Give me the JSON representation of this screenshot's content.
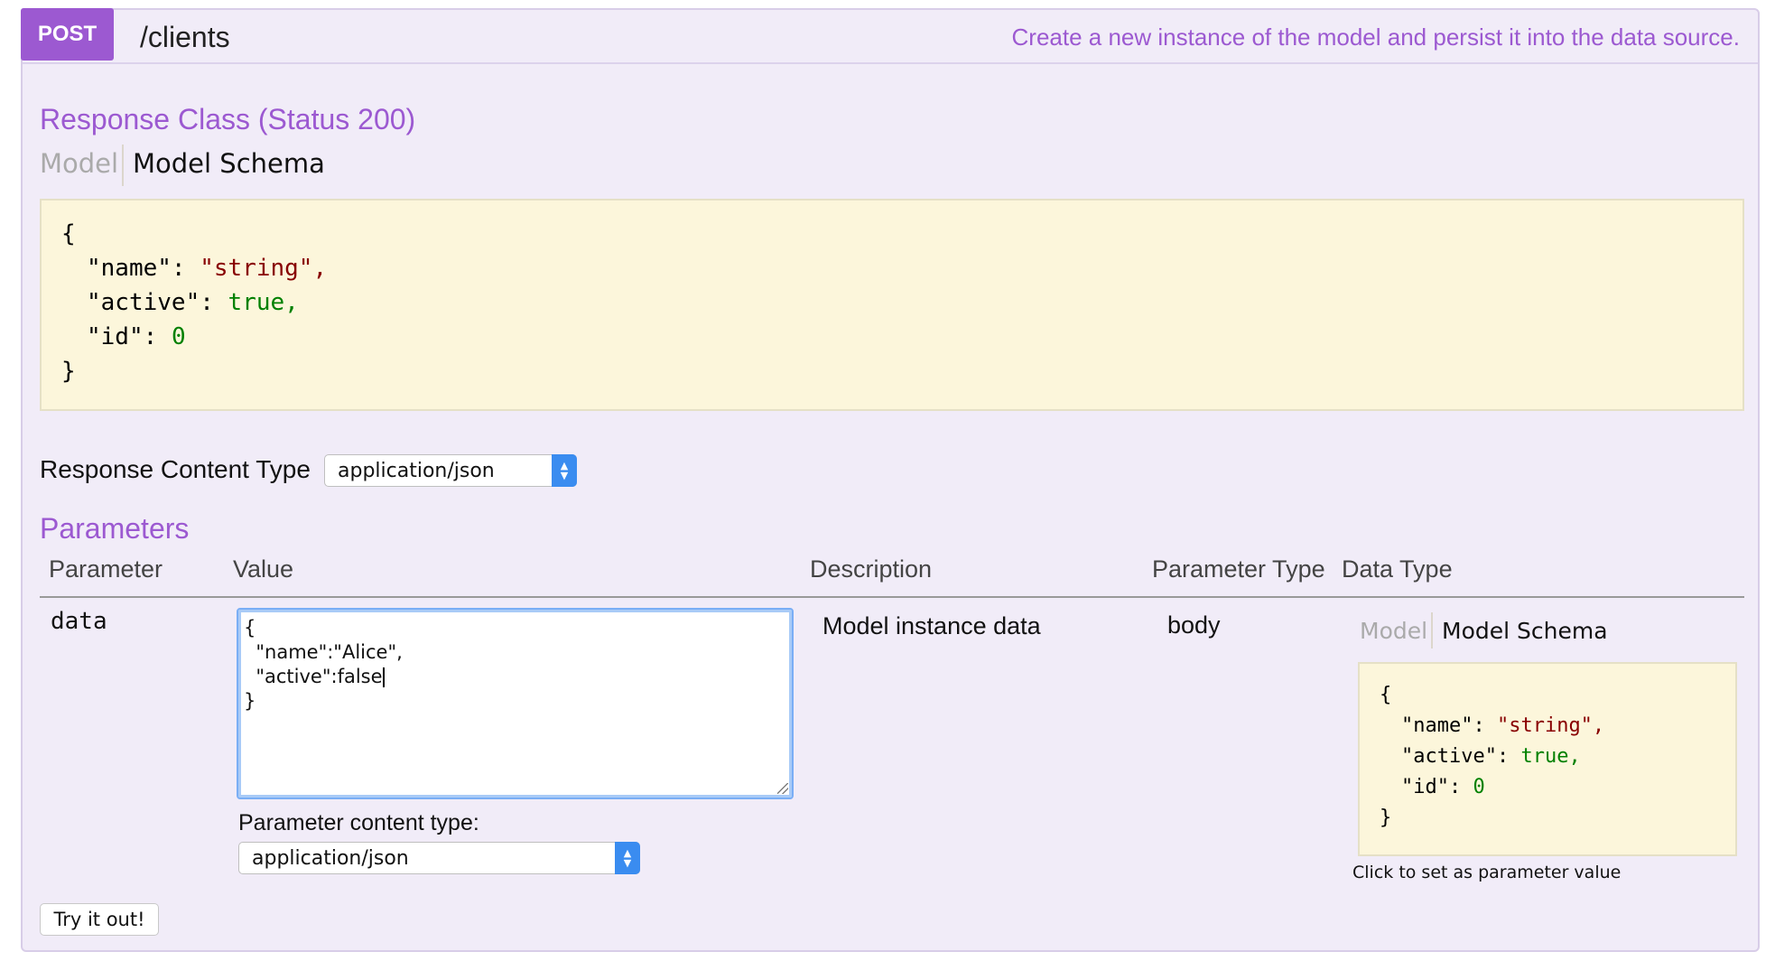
{
  "operation": {
    "method": "POST",
    "path": "/clients",
    "summary": "Create a new instance of the model and persist it into the data source."
  },
  "response_class": {
    "title": "Response Class (Status 200)",
    "tabs": [
      "Model",
      "Model Schema"
    ],
    "schema_lines": [
      "{",
      "\"name\":",
      "\"string\",",
      "\"active\":",
      "true,",
      "\"id\":",
      "0",
      "}"
    ]
  },
  "response_content_type": {
    "label": "Response Content Type",
    "selected": "application/json"
  },
  "parameters": {
    "title": "Parameters",
    "columns": [
      "Parameter",
      "Value",
      "Description",
      "Parameter Type",
      "Data Type"
    ],
    "row": {
      "name": "data",
      "value_lines": [
        "{",
        "  \"name\":\"Alice\",",
        "  \"active\":false",
        "}"
      ],
      "description": "Model instance data",
      "param_type": "body",
      "content_type_label": "Parameter content type:",
      "content_type_selected": "application/json",
      "data_type_tabs": [
        "Model",
        "Model Schema"
      ],
      "schema_hint": "Click to set as parameter value"
    }
  },
  "try_button": "Try it out!",
  "colors": {
    "accent": "#9c59d1",
    "panel": "#f1ecf8",
    "schema_bg": "#fcf6db"
  }
}
